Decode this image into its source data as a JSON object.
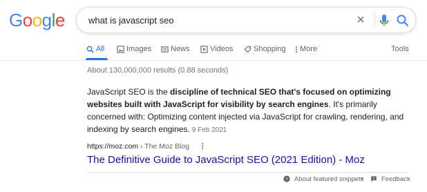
{
  "logo": {
    "letters": [
      "G",
      "o",
      "o",
      "g",
      "l",
      "e"
    ],
    "colors": [
      "#4285f4",
      "#ea4335",
      "#fbbc05",
      "#4285f4",
      "#34a853",
      "#ea4335"
    ]
  },
  "search": {
    "query": "what is javascript seo",
    "clear_glyph": "×"
  },
  "tabs": [
    {
      "label": "All",
      "icon": "search-icon"
    },
    {
      "label": "Images",
      "icon": "image-icon"
    },
    {
      "label": "News",
      "icon": "news-icon"
    },
    {
      "label": "Videos",
      "icon": "video-icon"
    },
    {
      "label": "Shopping",
      "icon": "tag-icon"
    },
    {
      "label": "More",
      "icon": "more-dots-icon"
    },
    {
      "label": "Tools",
      "icon": ""
    }
  ],
  "stats": "About 130,000,000 results (0.88 seconds)",
  "snippet": {
    "part1": "JavaScript SEO is the ",
    "bold": "discipline of technical SEO that's focused on optimizing websites built with JavaScript for visibility by search engines",
    "part2": ". It's primarily concerned with: Optimizing content injected via JavaScript for crawling, rendering, and indexing by search engines.",
    "date": "9 Feb 2021"
  },
  "result": {
    "url": "https://moz.com",
    "breadcrumb": " › The Moz Blog",
    "menu": "⋮",
    "title": "The Definitive Guide to JavaScript SEO (2021 Edition) - Moz"
  },
  "footer": {
    "about": "About featured snippets",
    "dot": "•",
    "feedback": "Feedback"
  },
  "colors": {
    "accent": "#1a73e8",
    "link": "#1a0dab"
  }
}
